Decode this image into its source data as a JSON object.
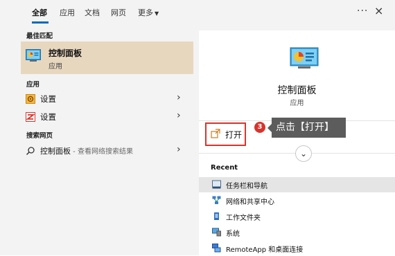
{
  "tabs": [
    {
      "label": "全部",
      "active": true
    },
    {
      "label": "应用"
    },
    {
      "label": "文档"
    },
    {
      "label": "网页"
    },
    {
      "label": "更多"
    }
  ],
  "colors": {
    "accent": "#0067c0",
    "highlight_box": "#d8342c",
    "selected_bg": "#e8d7bf",
    "callout_bg": "#5c5c5c"
  },
  "left": {
    "best_match_header": "最佳匹配",
    "best_match": {
      "title": "控制面板",
      "subtitle": "应用",
      "icon": "control-panel-icon"
    },
    "apps_header": "应用",
    "apps": [
      {
        "label": "设置",
        "icon": "settings-gear-icon"
      },
      {
        "label": "设置",
        "icon": "settings-alt-icon"
      }
    ],
    "web_header": "搜索网页",
    "web": {
      "label": "控制面板",
      "suffix": " - 查看网络搜索结果",
      "icon": "search-icon"
    }
  },
  "right": {
    "title": "控制面板",
    "subtitle": "应用",
    "open_label": "打开",
    "step_number": "3",
    "callout": "点击【打开】",
    "recent_header": "Recent",
    "recent": [
      {
        "label": "任务栏和导航",
        "icon": "taskbar-icon",
        "selected": true
      },
      {
        "label": "网络和共享中心",
        "icon": "network-icon"
      },
      {
        "label": "工作文件夹",
        "icon": "work-folders-icon"
      },
      {
        "label": "系统",
        "icon": "system-icon"
      },
      {
        "label": "RemoteApp 和桌面连接",
        "icon": "remoteapp-icon"
      }
    ]
  }
}
